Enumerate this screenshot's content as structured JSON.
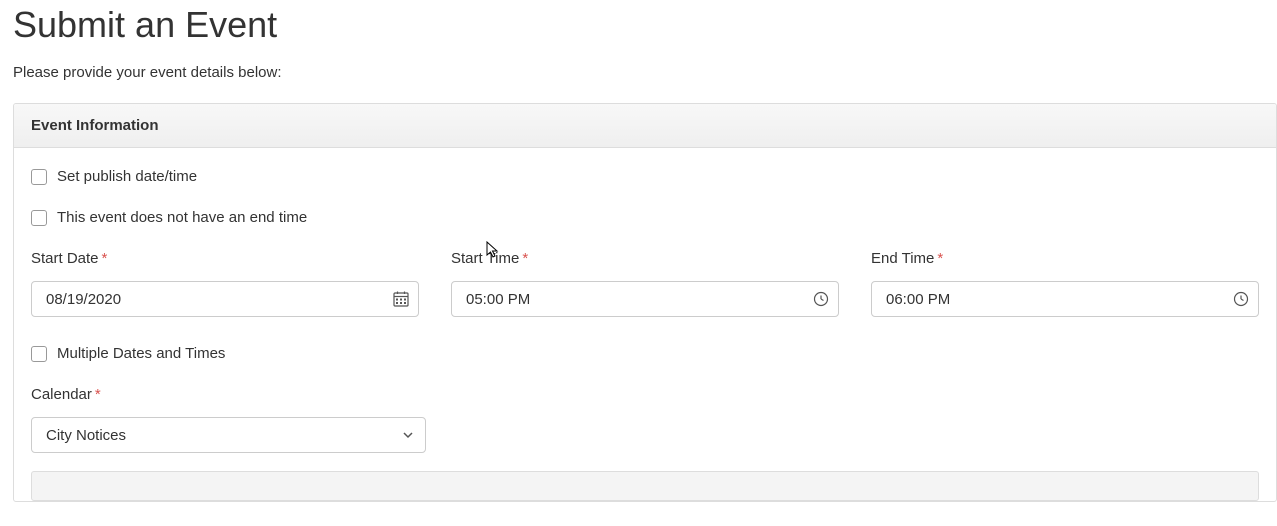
{
  "page": {
    "title": "Submit an Event",
    "subtitle": "Please provide your event details below:"
  },
  "panel": {
    "header": "Event Information"
  },
  "checkboxes": {
    "publish": "Set publish date/time",
    "no_end": "This event does not have an end time",
    "multiple": "Multiple Dates and Times"
  },
  "fields": {
    "start_date": {
      "label": "Start Date",
      "value": "08/19/2020"
    },
    "start_time": {
      "label": "Start Time",
      "value": "05:00 PM"
    },
    "end_time": {
      "label": "End Time",
      "value": "06:00 PM"
    },
    "calendar": {
      "label": "Calendar",
      "value": "City Notices"
    }
  },
  "required_marker": "*"
}
